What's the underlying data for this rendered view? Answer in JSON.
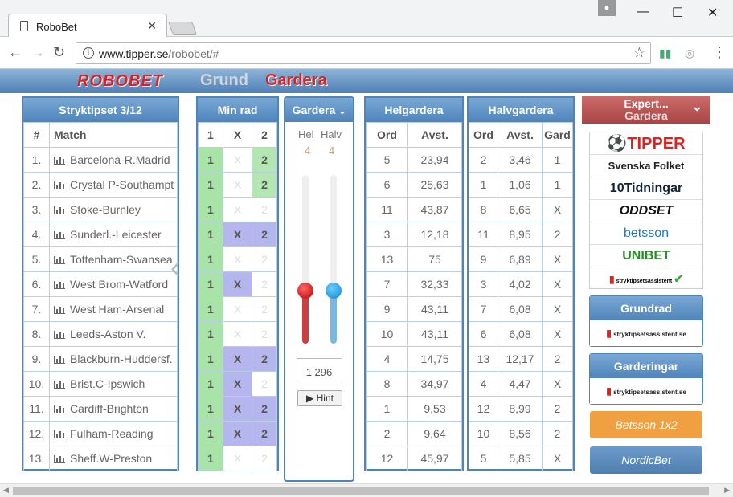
{
  "browser": {
    "tab_title": "RoboBet",
    "url_host": "www.tipper.se",
    "url_path": "/robobet/#"
  },
  "header": {
    "logo": "ROBOBET",
    "nav_grund": "Grund",
    "nav_gardera": "Gardera"
  },
  "stryktips": {
    "title": "Stryktipset 3/12",
    "col_num": "#",
    "col_match": "Match",
    "rows": [
      {
        "n": "1.",
        "match": "Barcelona-R.Madrid",
        "a": "1",
        "x": "X",
        "b": "2",
        "sel": [
          1,
          0,
          1
        ]
      },
      {
        "n": "2.",
        "match": "Crystal P-Southampt",
        "a": "1",
        "x": "X",
        "b": "2",
        "sel": [
          1,
          0,
          1
        ]
      },
      {
        "n": "3.",
        "match": "Stoke-Burnley",
        "a": "1",
        "x": "X",
        "b": "2",
        "sel": [
          1,
          0,
          0
        ]
      },
      {
        "n": "4.",
        "match": "Sunderl.-Leicester",
        "a": "1",
        "x": "X",
        "b": "2",
        "sel": [
          1,
          1,
          1
        ]
      },
      {
        "n": "5.",
        "match": "Tottenham-Swansea",
        "a": "1",
        "x": "X",
        "b": "2",
        "sel": [
          1,
          0,
          0
        ]
      },
      {
        "n": "6.",
        "match": "West Brom-Watford",
        "a": "1",
        "x": "X",
        "b": "2",
        "sel": [
          1,
          1,
          0
        ]
      },
      {
        "n": "7.",
        "match": "West Ham-Arsenal",
        "a": "1",
        "x": "X",
        "b": "2",
        "sel": [
          1,
          0,
          0
        ]
      },
      {
        "n": "8.",
        "match": "Leeds-Aston V.",
        "a": "1",
        "x": "X",
        "b": "2",
        "sel": [
          1,
          0,
          0
        ]
      },
      {
        "n": "9.",
        "match": "Blackburn-Huddersf.",
        "a": "1",
        "x": "X",
        "b": "2",
        "sel": [
          1,
          1,
          1
        ]
      },
      {
        "n": "10.",
        "match": "Brist.C-Ipswich",
        "a": "1",
        "x": "X",
        "b": "2",
        "sel": [
          1,
          1,
          0
        ]
      },
      {
        "n": "11.",
        "match": "Cardiff-Brighton",
        "a": "1",
        "x": "X",
        "b": "2",
        "sel": [
          1,
          1,
          1
        ]
      },
      {
        "n": "12.",
        "match": "Fulham-Reading",
        "a": "1",
        "x": "X",
        "b": "2",
        "sel": [
          1,
          1,
          1
        ]
      },
      {
        "n": "13.",
        "match": "Sheff.W-Preston",
        "a": "1",
        "x": "X",
        "b": "2",
        "sel": [
          1,
          0,
          0
        ]
      }
    ]
  },
  "minrad": {
    "title": "Min rad",
    "h1": "1",
    "hx": "X",
    "h2": "2"
  },
  "gardera": {
    "title": "Gardera",
    "hel_label": "Hel",
    "halv_label": "Halv",
    "hel_val": "4",
    "halv_val": "4",
    "hel_level": 0.33,
    "halv_level": 0.33,
    "rows": "1 296",
    "hint": "Hint"
  },
  "helgardera": {
    "title": "Helgardera",
    "col_ord": "Ord",
    "col_avst": "Avst.",
    "rows": [
      [
        "5",
        "23,94"
      ],
      [
        "6",
        "25,63"
      ],
      [
        "11",
        "43,87"
      ],
      [
        "3",
        "12,18"
      ],
      [
        "13",
        "75"
      ],
      [
        "7",
        "32,33"
      ],
      [
        "9",
        "43,11"
      ],
      [
        "10",
        "43,11"
      ],
      [
        "4",
        "14,75"
      ],
      [
        "8",
        "34,97"
      ],
      [
        "1",
        "9,53"
      ],
      [
        "2",
        "9,64"
      ],
      [
        "12",
        "45,97"
      ]
    ]
  },
  "halvgardera": {
    "title": "Halvgardera",
    "col_ord": "Ord",
    "col_avst": "Avst.",
    "col_gard": "Gard",
    "rows": [
      [
        "2",
        "3,46",
        "1"
      ],
      [
        "1",
        "1,06",
        "1"
      ],
      [
        "8",
        "6,65",
        "X"
      ],
      [
        "11",
        "8,95",
        "2"
      ],
      [
        "9",
        "6,89",
        "X"
      ],
      [
        "3",
        "4,02",
        "X"
      ],
      [
        "7",
        "6,08",
        "X"
      ],
      [
        "6",
        "6,08",
        "X"
      ],
      [
        "13",
        "12,17",
        "2"
      ],
      [
        "4",
        "4,47",
        "X"
      ],
      [
        "12",
        "8,99",
        "2"
      ],
      [
        "10",
        "8,56",
        "2"
      ],
      [
        "5",
        "5,85",
        "X"
      ]
    ]
  },
  "expert": {
    "line1": "Expert...",
    "line2": "Gardera"
  },
  "bookies": [
    "TIPPER",
    "Svenska Folket",
    "10Tidningar",
    "ODDSET",
    "betsson",
    "UNIBET",
    "stryktipsetsassistent"
  ],
  "buttons": {
    "grundrad": "Grundrad",
    "garderingar": "Garderingar",
    "badge": "stryktipsetsassistent.se",
    "betsson": "Betsson 1x2",
    "nordicbet": "NordicBet"
  },
  "colors": {
    "accent": "#4f84ba",
    "red": "#e0201e",
    "green": "#a8e3a8",
    "purple": "#b6b6ee"
  }
}
